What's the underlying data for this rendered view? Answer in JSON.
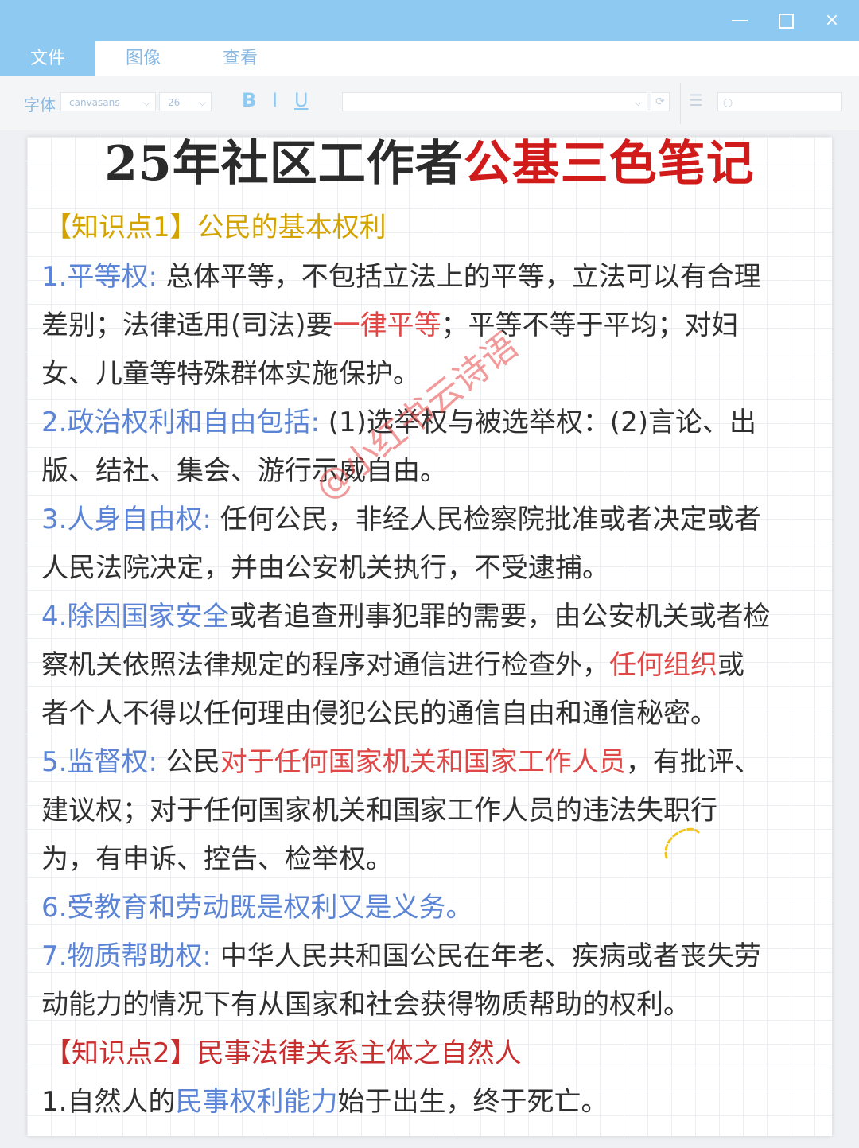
{
  "window": {
    "controls": {
      "minimize": "—",
      "maximize": "□",
      "close": "×"
    }
  },
  "menu": {
    "items": [
      "文件",
      "图像",
      "查看"
    ],
    "active": "文件"
  },
  "toolbar": {
    "font_label": "字体",
    "font_name": "canvasans",
    "font_size": "26",
    "bold": "B",
    "italic": "I",
    "underline": "U"
  },
  "colors": {
    "accent": "#8ec9f2",
    "blue_text": "#5b84d6",
    "red_text": "#e04848",
    "title_red": "#d11a1a",
    "gold_text": "#d4a300"
  },
  "document": {
    "title_black": "25年社区工作者",
    "title_red": "公基三色笔记",
    "section1_heading": "【知识点1】公民的基本权利",
    "l1a": "1.平等权:",
    "l1b": " 总体平等，不包括立法上的平等，立法可以有合理",
    "l2a": "差别；法律适用(司法)要",
    "l2b": "一律平等",
    "l2c": "；平等不等于平均；对妇",
    "l3": "女、儿童等特殊群体实施保护。",
    "l4a": "2.政治权利和自由包括:",
    "l4b": " (1)选举权与被选举权：(2)言论、出",
    "l5": "版、结社、集会、游行示威自由。",
    "l6a": "3.人身自由权:",
    "l6b": " 任何公民，非经人民检察院批准或者决定或者",
    "l7": "人民法院决定，并由公安机关执行，不受逮捕。",
    "l8a": "4.除因国家安全",
    "l8b": "或者追查刑事犯罪的需要，由公安机关或者检",
    "l9a": "察机关依照法律规定的程序对通信进行检查外，",
    "l9b": "任何组织",
    "l9c": "或",
    "l10": "者个人不得以任何理由侵犯公民的通信自由和通信秘密。",
    "l11a": "5.监督权:",
    "l11b": " 公民",
    "l11c": "对于任何国家机关和国家工作人员",
    "l11d": "，有批评、",
    "l12": "建议权；对于任何国家机关和国家工作人员的违法失职行",
    "l13": "为，有申诉、控告、检举权。",
    "l14": "6.受教育和劳动既是权利又是义务。",
    "l15a": "7.物质帮助权:",
    "l15b": " 中华人民共和国公民在年老、疾病或者丧失劳",
    "l16": "动能力的情况下有从国家和社会获得物质帮助的权利。",
    "section2_heading": "【知识点2】民事法律关系主体之自然人",
    "l17a": "1.自然人的",
    "l17b": "民事权利能力",
    "l17c": "始于出生，终于死亡。",
    "watermark": "@小红书云诗语"
  }
}
